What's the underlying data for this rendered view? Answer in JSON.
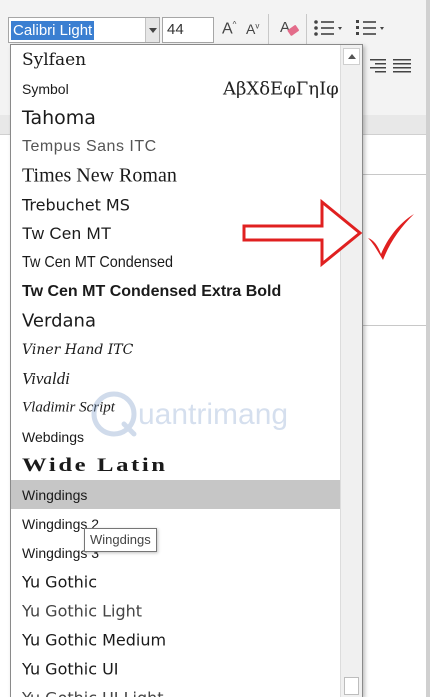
{
  "toolbar": {
    "font_name": "Calibri Light",
    "font_size": "44",
    "grow_font_icon": "increase-font-size-icon",
    "shrink_font_icon": "decrease-font-size-icon",
    "clear_formatting_icon": "clear-formatting-icon",
    "bullets_icon": "bullets-icon",
    "numbering_icon": "numbering-icon",
    "grow_label": "A",
    "shrink_label": "A"
  },
  "font_list": {
    "items": [
      {
        "label": "Sylfaen"
      },
      {
        "label": "Symbol",
        "sample": "ΑβΧδΕφΓηΙφ"
      },
      {
        "label": "Tahoma"
      },
      {
        "label": "Tempus Sans ITC"
      },
      {
        "label": "Times New Roman"
      },
      {
        "label": "Trebuchet MS"
      },
      {
        "label": "Tw Cen MT"
      },
      {
        "label": "Tw Cen MT Condensed"
      },
      {
        "label": "Tw Cen MT Condensed Extra Bold"
      },
      {
        "label": "Verdana"
      },
      {
        "label": "Viner Hand ITC"
      },
      {
        "label": "Vivaldi"
      },
      {
        "label": "Vladimir Script"
      },
      {
        "label": "Webdings"
      },
      {
        "label": "Wide Latin"
      },
      {
        "label": "Wingdings",
        "selected": true
      },
      {
        "label": "Wingdings 2"
      },
      {
        "label": "Wingdings 3"
      },
      {
        "label": "Yu Gothic"
      },
      {
        "label": "Yu Gothic Light"
      },
      {
        "label": "Yu Gothic Medium"
      },
      {
        "label": "Yu Gothic UI"
      },
      {
        "label": "Yu Gothic UI Light"
      }
    ]
  },
  "tooltip": {
    "text": "Wingdings"
  },
  "watermark": {
    "text": "uantrimang"
  },
  "colors": {
    "selection_blue": "#3b7fd1",
    "hover_gray": "#c6c6c6",
    "annotation_red": "#e02020"
  }
}
